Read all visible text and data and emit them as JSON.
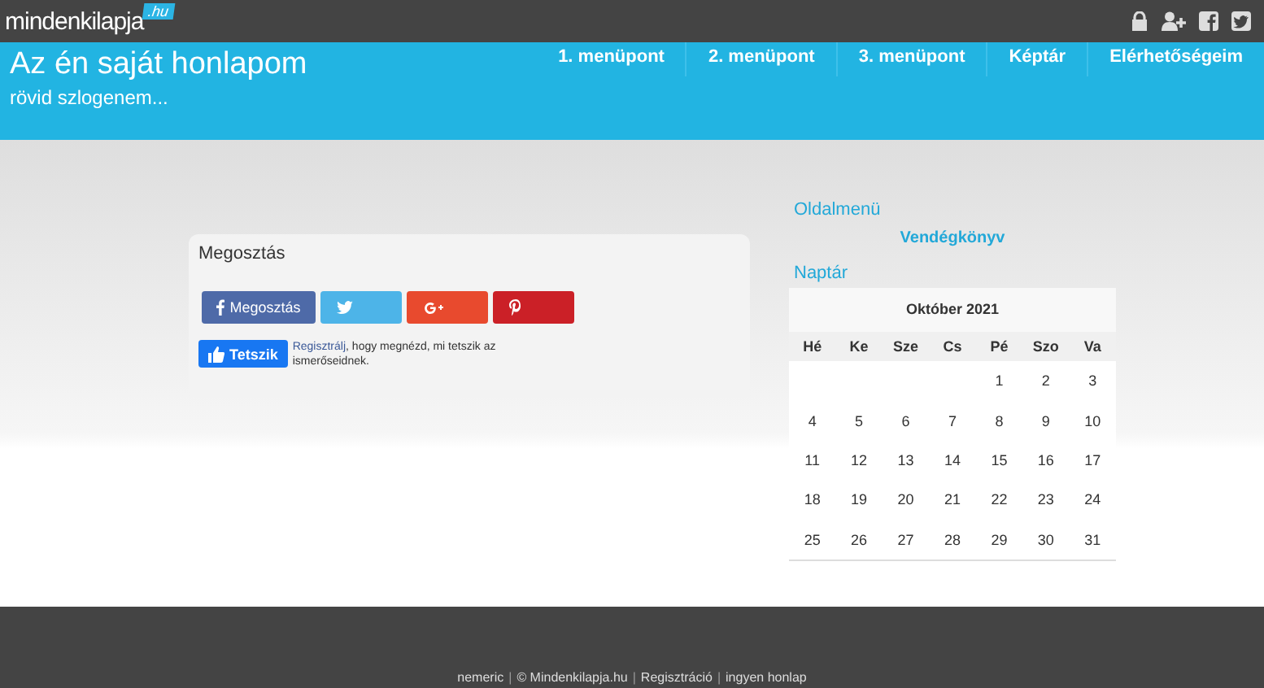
{
  "topbar": {
    "logo": "mindenkilapja",
    "logo_badge": ".hu"
  },
  "header": {
    "title": "Az én saját honlapom",
    "slogan": "rövid szlogenem...",
    "menu": [
      {
        "label": "1. menüpont"
      },
      {
        "label": "2. menüpont"
      },
      {
        "label": "3. menüpont"
      },
      {
        "label": "Képtár"
      },
      {
        "label": "Elérhetőségeim"
      }
    ]
  },
  "share_card": {
    "title": "Megosztás",
    "buttons": [
      {
        "kind": "facebook",
        "label": "Megosztás"
      },
      {
        "kind": "twitter"
      },
      {
        "kind": "googleplus"
      },
      {
        "kind": "pinterest"
      }
    ],
    "like_button": "Tetszik",
    "like_text": "**Regisztrálj**, hogy megnézd, mi tetszik az ismerőseidnek."
  },
  "sidebar": {
    "menu_title": "Oldalmenü",
    "menu_items": [
      "Vendégkönyv"
    ],
    "calendar_title": "Naptár",
    "calendar": {
      "month": "Október 2021",
      "weekdays": [
        "Hé",
        "Ke",
        "Sze",
        "Cs",
        "Pé",
        "Szo",
        "Va"
      ],
      "weeks": [
        [
          "1",
          "2",
          "3"
        ],
        [
          "4",
          "5",
          "6",
          "7",
          "8",
          "9",
          "10"
        ],
        [
          "11",
          "12",
          "13",
          "14",
          "15",
          "16",
          "17"
        ],
        [
          "18",
          "19",
          "20",
          "21",
          "22",
          "23",
          "24"
        ],
        [
          "25",
          "26",
          "27",
          "28",
          "29",
          "30",
          "31"
        ]
      ]
    }
  },
  "footer": {
    "separator": "|",
    "links": [
      "nemeric",
      "© Mindenkilapja.hu",
      "Regisztráció",
      "ingyen honlap"
    ]
  }
}
